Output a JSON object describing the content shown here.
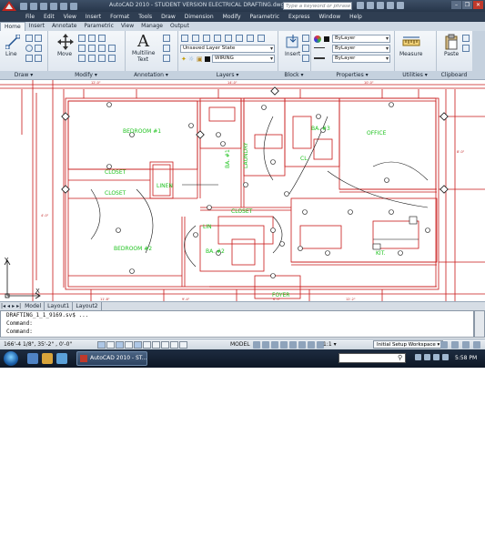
{
  "title_bar": {
    "title": "AutoCAD 2010 - STUDENT VERSION    ELECTRICAL DRAFTING.dwg",
    "search_placeholder": "Type a keyword or phrase"
  },
  "menu": [
    "File",
    "Edit",
    "View",
    "Insert",
    "Format",
    "Tools",
    "Draw",
    "Dimension",
    "Modify",
    "Parametric",
    "Express",
    "Window",
    "Help"
  ],
  "ribbon_tabs": [
    "Home",
    "Insert",
    "Annotate",
    "Parametric",
    "View",
    "Manage",
    "Output"
  ],
  "ribbon": {
    "draw": {
      "line_label": "Line",
      "panel": "Draw ▾"
    },
    "modify": {
      "move_label": "Move",
      "panel": "Modify ▾"
    },
    "annotation": {
      "text_label": "Multiline\nText",
      "text_line1": "Multiline",
      "text_line2": "Text",
      "panel": "Annotation ▾"
    },
    "layers": {
      "state": "Unsaved Layer State",
      "current": "WIRING",
      "panel": "Layers ▾"
    },
    "block": {
      "insert_label": "Insert",
      "panel": "Block ▾"
    },
    "properties": {
      "color": "ByLayer",
      "linetype": "ByLayer",
      "lineweight": "ByLayer",
      "panel": "Properties ▾"
    },
    "utilities": {
      "measure_label": "Measure",
      "panel": "Utilities ▾"
    },
    "clipboard": {
      "paste_label": "Paste",
      "panel": "Clipboard"
    }
  },
  "drawing": {
    "rooms": {
      "bedroom1": "BEDROOM  #1",
      "closet1": "CLOSET",
      "closet2": "CLOSET",
      "linen": "LINEN",
      "bedroom2": "BEDROOM  #2",
      "lin": "LIN",
      "closet3": "CLOSET",
      "bath1": "BA. #1",
      "bath2": "BA. #2",
      "bath3": "BA. #3",
      "laundry": "LAUNDRY",
      "office": "OFFICE",
      "cl": "CL.",
      "kit": "KIT.",
      "foyer": "FOYER"
    },
    "axis_y": "Y",
    "axis_x": "X"
  },
  "layout_tabs": [
    "Model",
    "Layout1",
    "Layout2"
  ],
  "command": {
    "line1": "DRAFTING_1_1_9169.sv$ ...",
    "line2": "Command:",
    "line3": "Command:"
  },
  "status": {
    "coords": "166'-4 1/8\",  35'-2\"  ,  0'-0\"",
    "model": "MODEL",
    "scale": "1:1 ▾",
    "workspace": "Initial Setup Workspace ▾"
  },
  "taskbar": {
    "task_label": "AutoCAD 2010 - ST...",
    "clock": "5:58 PM"
  },
  "colors": {
    "wall_line": "#c81818",
    "room_text": "#1ec21e",
    "fixture": "#111111"
  }
}
